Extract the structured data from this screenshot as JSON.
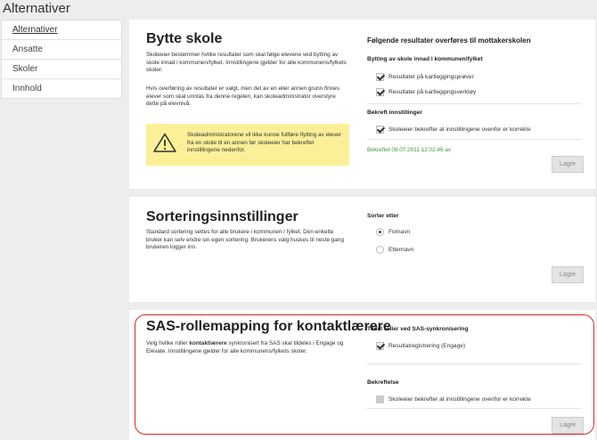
{
  "page": {
    "title": "Alternativer"
  },
  "sidebar": {
    "items": [
      {
        "label": "Alternativer"
      },
      {
        "label": "Ansatte"
      },
      {
        "label": "Skoler"
      },
      {
        "label": "Innhold"
      }
    ]
  },
  "bytte": {
    "title": "Bytte skole",
    "desc1": "Skoleeier bestemmer hvilke resultater som skal følge elevene ved bytting av skole innad i kommunen/fylket. Innstillingene gjelder for alle kommunens/fylkets skoler.",
    "desc2": "Hvis overføring av resultater er valgt, men det av en eller annen grunn finnes elever som skal unntas fra denne regelen, kan skoleadministrator overstyre dette på elevnivå.",
    "warning": "Skoleadministratorene vil ikke kunne fullføre flytting av elever fra en skole til en annen før skoleeier har bekreftet innstillingene nedenfor.",
    "right_title": "Følgende resultater overføres til mottakerskolen",
    "sub1": "Bytting av skole innad i kommunen/fylket",
    "cb1": "Resultater på kartleggingsprøver",
    "cb2": "Resultater på kartleggingsverktøy",
    "sub2": "Bekreft innstillinger",
    "cb3": "Skoleeier bekrefter at innstillingene ovenfor er korrekte",
    "confirmed": "Bekreftet 08.07.2011 12:02:46 av",
    "save": "Lagre"
  },
  "sort": {
    "title": "Sorteringsinnstillinger",
    "desc": "Standard sortering settes for alle brukere i kommunen / fylket. Den enkelte bruker kan selv endre sin egen sortering. Brukerens valg huskes til neste gang brukeren logger inn.",
    "right_title": "Sorter etter",
    "opt1": "Fornavn",
    "opt2": "Etternavn",
    "save": "Lagre"
  },
  "sas": {
    "title": "SAS-rollemapping for kontaktlærere",
    "desc_pre": "Velg hvilke roller ",
    "desc_bold": "kontaktlærere",
    "desc_post": " synkronisert fra SAS skal tildeles i Engage og Elevate. Innstillingene gjelder for alle kommunens/fylkets skoler.",
    "right_title": "Tildel roller ved SAS-synkronisering",
    "cb1": "Resultatregistrering (Engage)",
    "sub": "Bekreftelse",
    "cb2": "Skoleeier bekrefter at innstillingene ovenfor er korrekte",
    "save": "Lagre"
  },
  "colors": {
    "highlight": "#d9262b",
    "warning_bg": "#fbf098",
    "confirmed": "#3a9a3a"
  }
}
